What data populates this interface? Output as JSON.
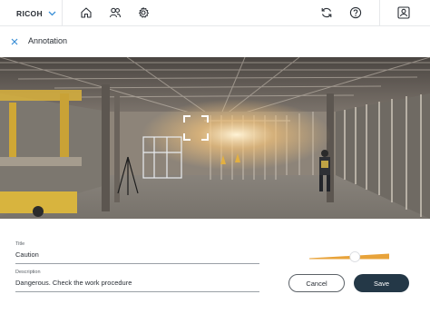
{
  "topbar": {
    "brand": "RICOH",
    "icons": [
      "home-icon",
      "people-icon",
      "gear-icon",
      "sync-icon",
      "help-icon",
      "profile-icon"
    ]
  },
  "subheader": {
    "title": "Annotation"
  },
  "form": {
    "title_label": "Title",
    "title_value": "Caution",
    "description_label": "Description",
    "description_value": "Dangerous. Check the work procedure"
  },
  "slider": {
    "value_fraction": 0.58,
    "accent": "#e8a33a"
  },
  "buttons": {
    "cancel": "Cancel",
    "save": "Save"
  },
  "colors": {
    "accent": "#e8a33a",
    "primary_button": "#243847"
  }
}
